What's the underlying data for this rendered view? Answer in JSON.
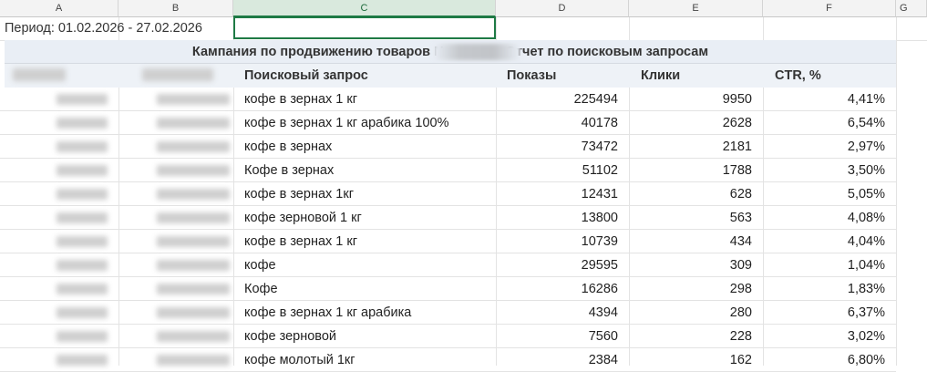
{
  "columns": [
    "A",
    "B",
    "C",
    "D",
    "E",
    "F",
    "G"
  ],
  "period_label": "Период: 01.02.2026 - 27.02.2026",
  "title_part1": "Кампания по продвижению товаров N",
  "title_part2": ". Отчет по поисковым запросам",
  "headers": {
    "query": "Поисковый запрос",
    "impressions": "Показы",
    "clicks": "Клики",
    "ctr": "CTR, %"
  },
  "rows": [
    {
      "query": "кофе в зернах 1 кг",
      "impressions": "225494",
      "clicks": "9950",
      "ctr": "4,41%"
    },
    {
      "query": "кофе в зернах 1 кг арабика 100%",
      "impressions": "40178",
      "clicks": "2628",
      "ctr": "6,54%"
    },
    {
      "query": "кофе в зернах",
      "impressions": "73472",
      "clicks": "2181",
      "ctr": "2,97%"
    },
    {
      "query": "Кофе в зернах",
      "impressions": "51102",
      "clicks": "1788",
      "ctr": "3,50%"
    },
    {
      "query": "кофе в зернах 1кг",
      "impressions": "12431",
      "clicks": "628",
      "ctr": "5,05%"
    },
    {
      "query": "кофе зерновой 1 кг",
      "impressions": "13800",
      "clicks": "563",
      "ctr": "4,08%"
    },
    {
      "query": "кофе в зернах 1 кг",
      "impressions": "10739",
      "clicks": "434",
      "ctr": "4,04%"
    },
    {
      "query": "кофе",
      "impressions": "29595",
      "clicks": "309",
      "ctr": "1,04%"
    },
    {
      "query": "Кофе",
      "impressions": "16286",
      "clicks": "298",
      "ctr": "1,83%"
    },
    {
      "query": "кофе в зернах 1 кг арабика",
      "impressions": "4394",
      "clicks": "280",
      "ctr": "6,37%"
    },
    {
      "query": "кофе зерновой",
      "impressions": "7560",
      "clicks": "228",
      "ctr": "3,02%"
    },
    {
      "query": "кофе молотый 1кг",
      "impressions": "2384",
      "clicks": "162",
      "ctr": "6,80%"
    }
  ]
}
